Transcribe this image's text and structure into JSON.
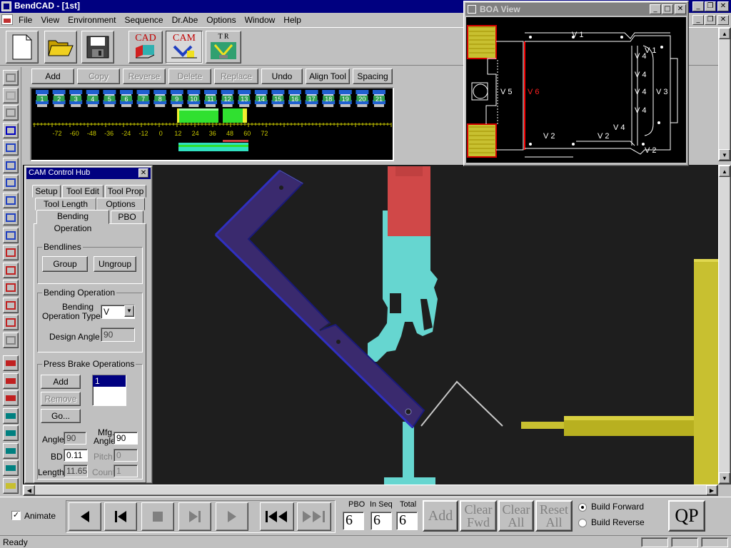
{
  "app": {
    "title": "BendCAD - [1st]",
    "menu": [
      "File",
      "View",
      "Environment",
      "Sequence",
      "Dr.Abe",
      "Options",
      "Window",
      "Help"
    ],
    "toolbar_icons": [
      "new-file-icon",
      "open-folder-icon",
      "save-disk-icon",
      "cad-mode-icon",
      "cam-mode-icon",
      "tooling-mode-icon"
    ],
    "cad_label": "CAD",
    "cam_label": "CAM",
    "tooling_label": "T R"
  },
  "sequence_toolbar": {
    "buttons": [
      {
        "label": "Add",
        "enabled": true
      },
      {
        "label": "Copy",
        "enabled": false
      },
      {
        "label": "Reverse",
        "enabled": false
      },
      {
        "label": "Delete",
        "enabled": false
      },
      {
        "label": "Replace",
        "enabled": false
      },
      {
        "label": "Undo",
        "enabled": true
      },
      {
        "label": "Align Tool",
        "enabled": true
      },
      {
        "label": "Spacing",
        "enabled": true
      }
    ]
  },
  "tool_layout": {
    "stations": [
      "1",
      "2",
      "3",
      "4",
      "5",
      "6",
      "7",
      "8",
      "9",
      "10",
      "11",
      "12",
      "13",
      "14",
      "15",
      "16",
      "17",
      "18",
      "19",
      "20",
      "21"
    ],
    "ruler_ticks": [
      "-72",
      "-60",
      "-48",
      "-36",
      "-24",
      "-12",
      "0",
      "12",
      "24",
      "36",
      "48",
      "60",
      "72"
    ]
  },
  "boa_view": {
    "title": "BOA View",
    "labels": {
      "v1_top": "V 1",
      "v1_right": "V 1",
      "v5": "V 5",
      "v6": "V 6",
      "v4_a": "V 4",
      "v4_b": "V 4",
      "v4_c": "V 4",
      "v4_d": "V 4",
      "v4_e": "V 4",
      "v3": "V 3",
      "v2_a": "V 2",
      "v2_b": "V 2",
      "v2_c": "V 2"
    }
  },
  "cam_hub": {
    "title": "CAM Control Hub",
    "tabs_row1": [
      "Setup",
      "Tool Edit",
      "Tool Prop"
    ],
    "tabs_row2": [
      "Tool Length",
      "Options"
    ],
    "tabs_row3": [
      "Bending Operation",
      "PBO"
    ],
    "active_tab": "Bending Operation",
    "bendlines": {
      "title": "Bendlines",
      "group": "Group",
      "ungroup": "Ungroup"
    },
    "bending_operation": {
      "title": "Bending Operation",
      "type_label_1": "Bending",
      "type_label_2": "Operation Type",
      "type_value": "V",
      "angle_label": "Design Angle",
      "angle_value": "90"
    },
    "press_brake": {
      "title": "Press Brake Operations",
      "add": "Add",
      "remove": "Remove",
      "go": "Go...",
      "list": [
        "1"
      ],
      "angle_label": "Angle",
      "angle_value": "90",
      "mfg_label_1": "Mfg.",
      "mfg_label_2": "Angle",
      "mfg_value": "90",
      "bd_label": "BD",
      "bd_value": "0.11",
      "pitch_label": "Pitch",
      "pitch_value": "0",
      "length_label": "Length",
      "length_value": "11.65",
      "count_label": "Count",
      "count_value": "1"
    }
  },
  "playback": {
    "animate_label": "Animate",
    "animate_checked": true,
    "pbo_label": "PBO",
    "pbo_value": "6",
    "inseq_label": "In Seq",
    "inseq_value": "6",
    "total_label": "Total",
    "total_value": "6",
    "add": "Add",
    "clear_fwd_1": "Clear",
    "clear_fwd_2": "Fwd",
    "clear_all_1": "Clear",
    "clear_all_2": "All",
    "reset_all_1": "Reset",
    "reset_all_2": "All",
    "build_forward": "Build Forward",
    "build_reverse": "Build Reverse",
    "build_selected": "forward",
    "qp": "QP"
  },
  "status": {
    "text": "Ready"
  },
  "colors": {
    "title_bar": "#000080",
    "viewport_bg": "#1e1e1e",
    "part": "#3a2a6e",
    "punch": "#d04848",
    "holder": "#66d6d0",
    "backgauge": "#c8c030"
  }
}
